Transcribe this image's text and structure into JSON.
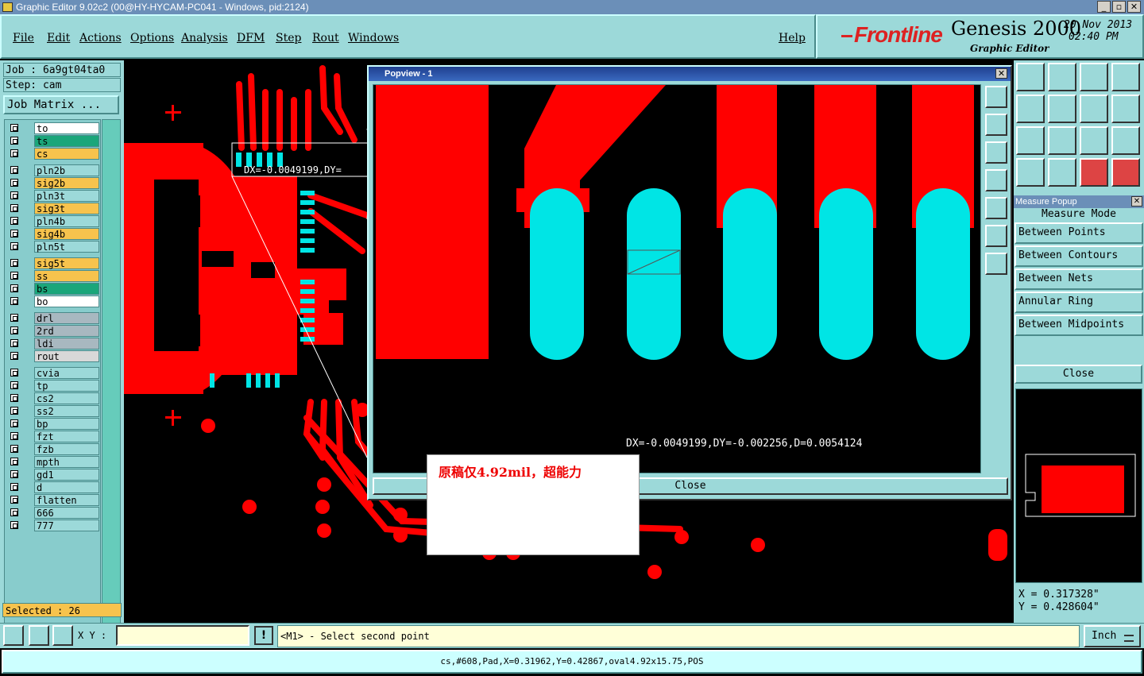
{
  "window": {
    "title": "Graphic Editor 9.02c2 (00@HY-HYCAM-PC041 - Windows, pid:2124)"
  },
  "menu": [
    "File",
    "Edit",
    "Actions",
    "Options",
    "Analysis",
    "DFM",
    "Step",
    "Rout",
    "Windows"
  ],
  "help": "Help",
  "brand": {
    "logo": "Frontline",
    "product": "Genesis 2000",
    "subtitle": "Graphic Editor",
    "date": "20 Nov 2013",
    "time": "02:40 PM"
  },
  "job": {
    "job_line": "Job : 6a9gt04ta0",
    "step_line": "Step: cam",
    "matrix_button": "Job Matrix ..."
  },
  "layers": [
    {
      "name": "to",
      "color": "#ffffff"
    },
    {
      "name": "ts",
      "color": "#1aa67a"
    },
    {
      "name": "cs",
      "color": "#f7c34d"
    },
    {
      "name": "pln2b",
      "color": "#9cd9d9"
    },
    {
      "name": "sig2b",
      "color": "#f7c34d"
    },
    {
      "name": "pln3t",
      "color": "#9cd9d9"
    },
    {
      "name": "sig3t",
      "color": "#f7c34d"
    },
    {
      "name": "pln4b",
      "color": "#9cd9d9"
    },
    {
      "name": "sig4b",
      "color": "#f7c34d"
    },
    {
      "name": "pln5t",
      "color": "#9cd9d9"
    },
    {
      "name": "sig5t",
      "color": "#f7c34d"
    },
    {
      "name": "ss",
      "color": "#f7c34d"
    },
    {
      "name": "bs",
      "color": "#1aa67a"
    },
    {
      "name": "bo",
      "color": "#ffffff"
    },
    {
      "name": "drl",
      "color": "#a8b8c0"
    },
    {
      "name": "2rd",
      "color": "#a8b8c0"
    },
    {
      "name": "ldi",
      "color": "#a8b8c0"
    },
    {
      "name": "rout",
      "color": "#d8d8d8"
    },
    {
      "name": "cvia",
      "color": "#9cd9d9"
    },
    {
      "name": "tp",
      "color": "#9cd9d9"
    },
    {
      "name": "cs2",
      "color": "#9cd9d9"
    },
    {
      "name": "ss2",
      "color": "#9cd9d9"
    },
    {
      "name": "bp",
      "color": "#9cd9d9"
    },
    {
      "name": "fzt",
      "color": "#9cd9d9"
    },
    {
      "name": "fzb",
      "color": "#9cd9d9"
    },
    {
      "name": "mpth",
      "color": "#9cd9d9"
    },
    {
      "name": "gd1",
      "color": "#9cd9d9"
    },
    {
      "name": "d",
      "color": "#9cd9d9"
    },
    {
      "name": "flatten",
      "color": "#9cd9d9"
    },
    {
      "name": "666",
      "color": "#9cd9d9"
    },
    {
      "name": "777",
      "color": "#9cd9d9"
    }
  ],
  "selected": "Selected : 26",
  "canvas": {
    "measure_label": "DX=-0.0049199,DY="
  },
  "popview": {
    "title": "Popview - 1",
    "measure_text": "DX=-0.0049199,DY=-0.002256,D=0.0054124",
    "close": "Close"
  },
  "note": "原稿仅4.92mil，超能力",
  "measure_popup": {
    "title": "Measure Popup",
    "mode_label": "Measure Mode",
    "options": [
      "Between Points",
      "Between Contours",
      "Between Nets",
      "Annular Ring",
      "Between Midpoints"
    ],
    "close": "Close"
  },
  "coords": {
    "x": "X = 0.317328\"",
    "y": "Y = 0.428604\""
  },
  "bottom": {
    "xy_label": "X Y :",
    "xy_value": "",
    "prompt": "<M1> - Select second point",
    "units": "Inch"
  },
  "status": "cs,#608,Pad,X=0.31962,Y=0.42867,oval4.92x15.75,POS",
  "colors": {
    "panel": "#9cd9d9",
    "copper": "#ff0000",
    "pad": "#00e5e5"
  }
}
